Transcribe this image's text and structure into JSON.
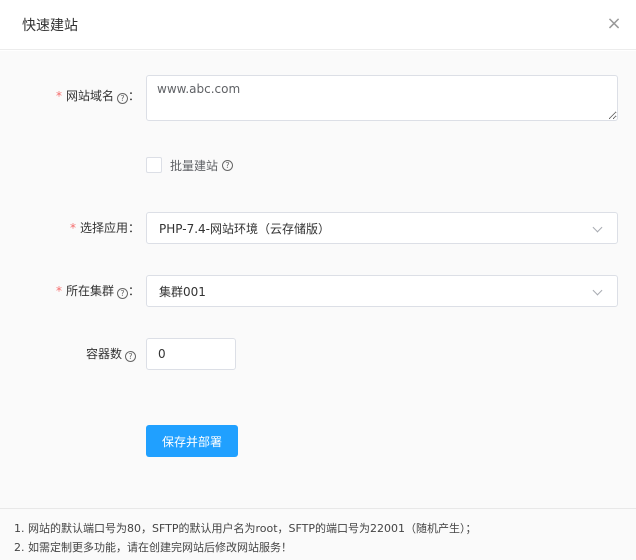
{
  "dialog": {
    "title": "快速建站",
    "close_symbol": "×"
  },
  "form": {
    "domain": {
      "label": "网站域名",
      "placeholder": "www.abc.com",
      "value": ""
    },
    "batch": {
      "label": "批量建站",
      "checked": false
    },
    "app": {
      "label": "选择应用",
      "value": "PHP-7.4-网站环境（云存储版）"
    },
    "cluster": {
      "label": "所在集群",
      "value": "集群001"
    },
    "containers": {
      "label": "容器数",
      "value": "0"
    },
    "submit_label": "保存并部署"
  },
  "footer": {
    "notes": [
      "1. 网站的默认端口号为80，SFTP的默认用户名为root，SFTP的端口号为22001（随机产生）；",
      "2. 如需定制更多功能，请在创建完网站后修改网站服务！"
    ]
  },
  "colors": {
    "primary": "#20a0ff",
    "required": "#f56c6c"
  }
}
